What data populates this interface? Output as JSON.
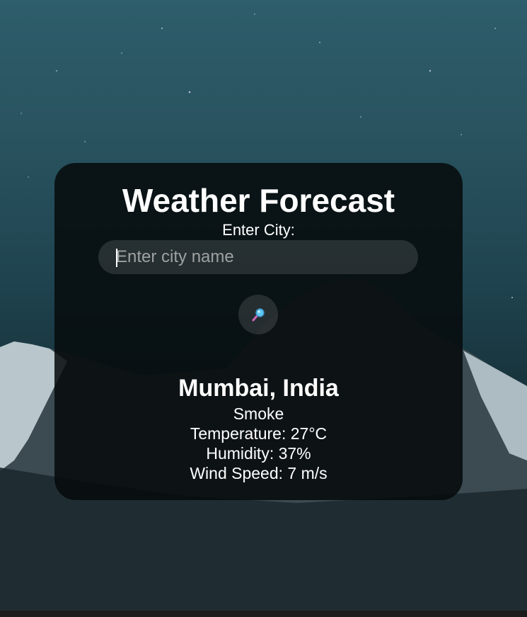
{
  "app": {
    "title": "Weather Forecast"
  },
  "search": {
    "label": "Enter City:",
    "placeholder": "Enter city name",
    "value": "",
    "button_icon": "search-icon"
  },
  "weather": {
    "location": "Mumbai, India",
    "description": "Smoke",
    "temperature": "Temperature: 27°C",
    "humidity": "Humidity: 37%",
    "wind_speed": "Wind Speed: 7 m/s"
  },
  "colors": {
    "card_background": "#0a0e10",
    "text": "#ffffff",
    "sky_top": "#2e5d6b",
    "sky_bottom": "#142429",
    "icon_blue": "#5ec8f0",
    "icon_pink": "#c86ab8"
  }
}
